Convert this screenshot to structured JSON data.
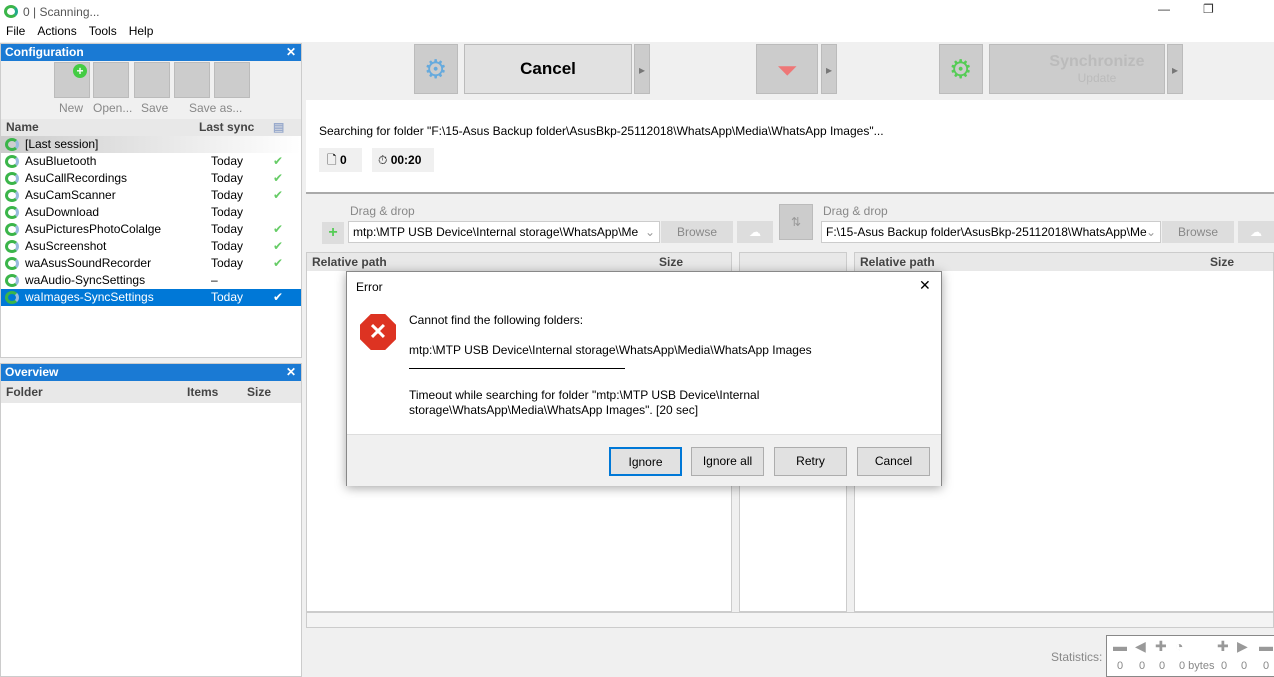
{
  "window": {
    "title": "0 | Scanning..."
  },
  "menu": [
    "File",
    "Actions",
    "Tools",
    "Help"
  ],
  "configuration": {
    "title": "Configuration",
    "toolbar": [
      "New",
      "Open...",
      "Save",
      "Save as..."
    ],
    "columns": {
      "name": "Name",
      "last_sync": "Last sync"
    },
    "items": [
      {
        "name": "[Last session]",
        "last_sync": "",
        "ok": false
      },
      {
        "name": "AsuBluetooth",
        "last_sync": "Today",
        "ok": true
      },
      {
        "name": "AsuCallRecordings",
        "last_sync": "Today",
        "ok": true
      },
      {
        "name": "AsuCamScanner",
        "last_sync": "Today",
        "ok": true
      },
      {
        "name": "AsuDownload",
        "last_sync": "Today",
        "ok": false
      },
      {
        "name": "AsuPicturesPhotoColalge",
        "last_sync": "Today",
        "ok": true
      },
      {
        "name": "AsuScreenshot",
        "last_sync": "Today",
        "ok": true
      },
      {
        "name": "waAsusSoundRecorder",
        "last_sync": "Today",
        "ok": true
      },
      {
        "name": "waAudio-SyncSettings",
        "last_sync": "–",
        "ok": false
      },
      {
        "name": "waImages-SyncSettings",
        "last_sync": "Today",
        "ok": true,
        "selected": true
      }
    ]
  },
  "overview": {
    "title": "Overview",
    "columns": [
      "Folder",
      "Items",
      "Size"
    ]
  },
  "toolbar": {
    "cancel": "Cancel",
    "synchronize": "Synchronize",
    "update": "Update"
  },
  "status": {
    "message": "Searching for folder \"F:\\15-Asus Backup folder\\AsusBkp-25112018\\WhatsApp\\Media\\WhatsApp Images\"...",
    "items": "0",
    "time": "00:20"
  },
  "left_folder": {
    "hint": "Drag & drop",
    "path": "mtp:\\MTP USB Device\\Internal storage\\WhatsApp\\Me",
    "browse": "Browse"
  },
  "right_folder": {
    "hint": "Drag & drop",
    "path": "F:\\15-Asus Backup folder\\AsusBkp-25112018\\WhatsApp\\Me",
    "browse": "Browse"
  },
  "grid": {
    "left_col": "Relative path",
    "left_size": "Size",
    "right_col": "Relative path",
    "right_size": "Size"
  },
  "statistics": {
    "label": "Statistics:",
    "values": [
      "0",
      "0",
      "0",
      "0 bytes",
      "0",
      "0",
      "0"
    ]
  },
  "dialog": {
    "title": "Error",
    "heading": "Cannot find the following folders:",
    "path": "mtp:\\MTP USB Device\\Internal storage\\WhatsApp\\Media\\WhatsApp Images",
    "detail": "Timeout while searching for folder \"mtp:\\MTP USB Device\\Internal storage\\WhatsApp\\Media\\WhatsApp Images\". [20 sec]",
    "buttons": [
      "Ignore",
      "Ignore all",
      "Retry",
      "Cancel"
    ]
  }
}
